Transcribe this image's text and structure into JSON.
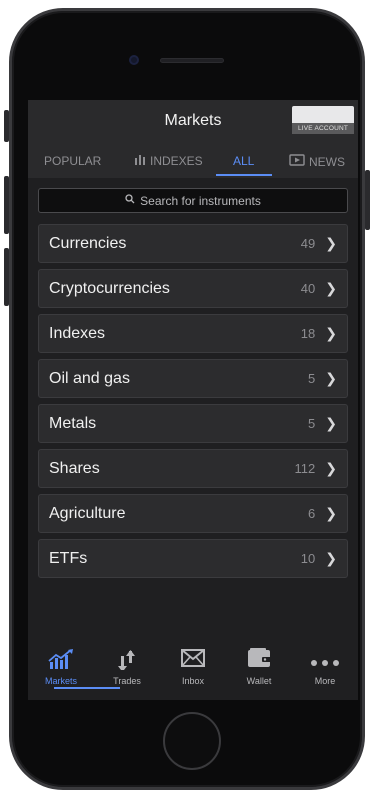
{
  "header": {
    "title": "Markets",
    "account_label": "LIVE ACCOUNT"
  },
  "tabs": [
    {
      "label": "POPULAR",
      "icon": "",
      "active": false
    },
    {
      "label": "INDEXES",
      "icon": "indexes-icon",
      "active": false
    },
    {
      "label": "ALL",
      "icon": "",
      "active": true
    },
    {
      "label": "NEWS",
      "icon": "tv-icon",
      "active": false
    }
  ],
  "search": {
    "placeholder": "Search for instruments"
  },
  "categories": [
    {
      "label": "Currencies",
      "count": "49"
    },
    {
      "label": "Cryptocurrencies",
      "count": "40"
    },
    {
      "label": "Indexes",
      "count": "18"
    },
    {
      "label": "Oil and gas",
      "count": "5"
    },
    {
      "label": "Metals",
      "count": "5"
    },
    {
      "label": "Shares",
      "count": "112"
    },
    {
      "label": "Agriculture",
      "count": "6"
    },
    {
      "label": "ETFs",
      "count": "10"
    }
  ],
  "bottom_nav": [
    {
      "label": "Markets",
      "icon": "chart-icon",
      "active": true
    },
    {
      "label": "Trades",
      "icon": "arrows-updown-icon",
      "active": false
    },
    {
      "label": "Inbox",
      "icon": "envelope-icon",
      "active": false
    },
    {
      "label": "Wallet",
      "icon": "wallet-icon",
      "active": false
    },
    {
      "label": "More",
      "icon": "more-icon",
      "active": false
    }
  ],
  "colors": {
    "accent": "#5b8df5",
    "background": "#1f1f21",
    "row": "#2c2c2e"
  }
}
